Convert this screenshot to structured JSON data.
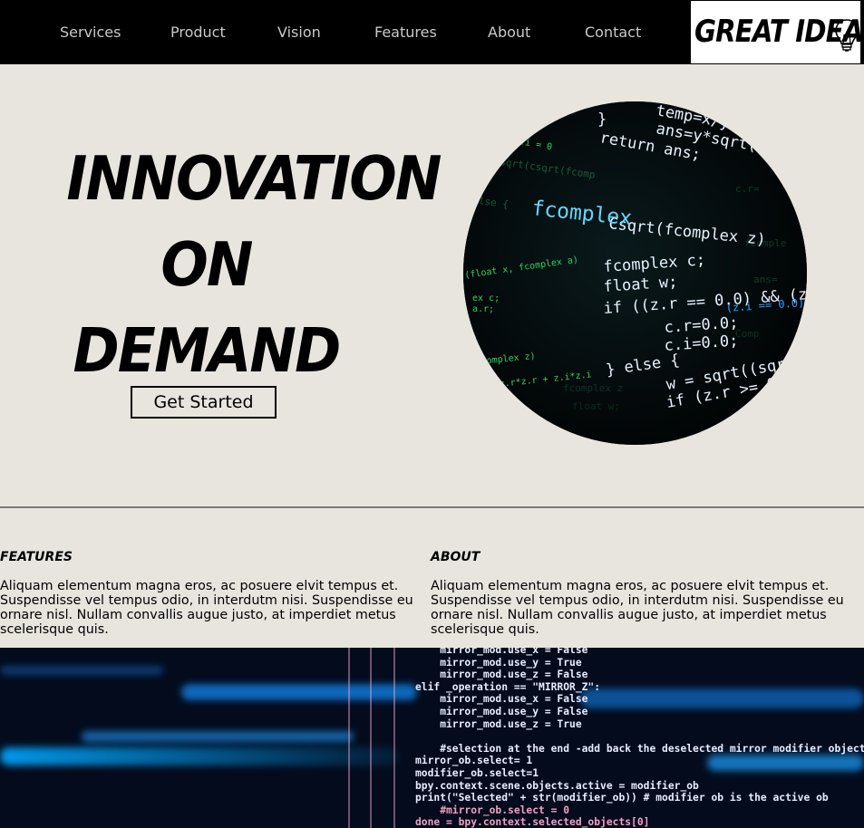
{
  "nav": {
    "items": [
      "Services",
      "Product",
      "Vision",
      "Features",
      "About",
      "Contact"
    ]
  },
  "logo": {
    "text": "GREAT IDEA",
    "icon": "lightbulb-icon"
  },
  "hero": {
    "title_lines": [
      "INNOVATION",
      "ON",
      "DEMAND"
    ],
    "cta_label": "Get Started",
    "image": "circular code screenshot"
  },
  "columns": [
    {
      "title": "FEATURES",
      "body": "Aliquam elementum magna eros, ac posuere elvit tempus et. Suspendisse vel tempus odio, in interdutm nisi. Suspendisse eu ornare nisl. Nullam convallis augue justo, at imperdiet metus scelerisque quis."
    },
    {
      "title": "ABOUT",
      "body": "Aliquam elementum magna eros, ac posuere elvit tempus et. Suspendisse vel tempus odio, in interdutm nisi. Suspendisse eu ornare nisl. Nullam convallis augue justo, at imperdiet metus scelerisque quis."
    }
  ],
  "code_image": {
    "lines": [
      "    mirror_mod.use_x = False",
      "    mirror_mod.use_y = True",
      "    mirror_mod.use_z = False",
      "elif _operation == \"MIRROR_Z\":",
      "    mirror_mod.use_x = False",
      "    mirror_mod.use_y = False",
      "    mirror_mod.use_z = True",
      "",
      "    #selection at the end -add back the deselected mirror modifier object",
      "mirror_ob.select= 1",
      "modifier_ob.select=1",
      "bpy.context.scene.objects.active = modifier_ob",
      "print(\"Selected\" + str(modifier_ob)) # modifier ob is the active ob",
      "    #mirror_ob.select = 0",
      "done = bpy.context.selected_objects[0]"
    ]
  },
  "colors": {
    "background": "#e8e5df",
    "topbar": "#000000",
    "nav_text": "#c9c9c9",
    "code_green": "#3ddc6a",
    "code_white": "#e6f3ff"
  }
}
